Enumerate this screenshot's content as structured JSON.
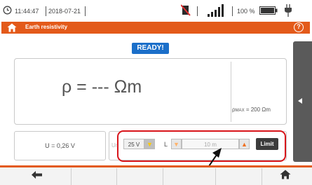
{
  "status_bar": {
    "time": "11:44:47",
    "date": "2018-07-21",
    "battery_percent": "100 %"
  },
  "header": {
    "title": "Earth resistivity"
  },
  "status_badge": "READY!",
  "result": {
    "value_text": "ρ = --- Ωm",
    "rho_max_prefix": "ρ",
    "rho_max_sub": "MAX",
    "rho_max_value": "= 200 Ωm"
  },
  "measurement": {
    "voltage": "U = 0,26 V"
  },
  "settings": {
    "un_label": "Un",
    "un_value": "25 V",
    "l_label": "L",
    "l_value": "10 m",
    "limit_label": "Limit"
  },
  "colors": {
    "accent": "#e35a1a",
    "ready_badge": "#1b6fc9",
    "highlight": "#d8151b"
  },
  "icons": {
    "clock": "clock-icon",
    "no_signal": "no-signal-icon",
    "signal_bars": "signal-strength-icon",
    "battery": "battery-icon",
    "power_plug": "power-plug-icon",
    "home": "home-icon",
    "help": "help-icon",
    "back": "back-arrow-icon",
    "side_tab": "chevron-left-icon"
  }
}
